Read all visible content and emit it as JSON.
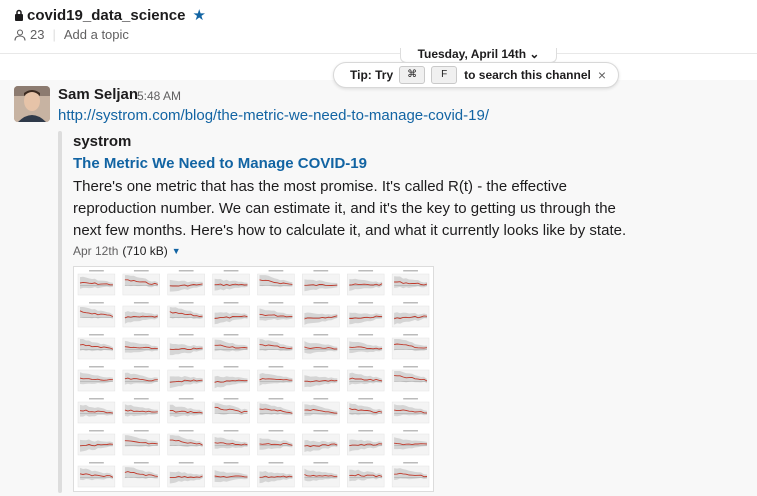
{
  "header": {
    "channel_name": "covid19_data_science",
    "member_count": "23",
    "add_topic": "Add a topic"
  },
  "date_divider": {
    "label": "Tuesday, April 14th ⌄"
  },
  "tip": {
    "prefix": "Tip: Try",
    "key1": "⌘",
    "key2": "F",
    "suffix": "to search this channel",
    "close": "×"
  },
  "message": {
    "sender": "Sam Seljan",
    "time": "5:48 AM",
    "link": "http://systrom.com/blog/the-metric-we-need-to-manage-covid-19/",
    "attachment": {
      "author": "systrom",
      "title": "The Metric We Need to Manage COVID-19",
      "body": "There's one metric that has the most promise. It's called R(t) - the effective reproduction number. We can estimate it, and it's the key to getting us through the next few months. Here's how to calculate it, and what it currently looks like by state.",
      "date": "Apr 12th",
      "size": "(710 kB)",
      "image_grid": {
        "rows": 7,
        "cols": 8
      }
    }
  },
  "colors": {
    "link": "#1264a3",
    "message_bg": "#f8f8f8",
    "plot_line": "#c0392b"
  }
}
